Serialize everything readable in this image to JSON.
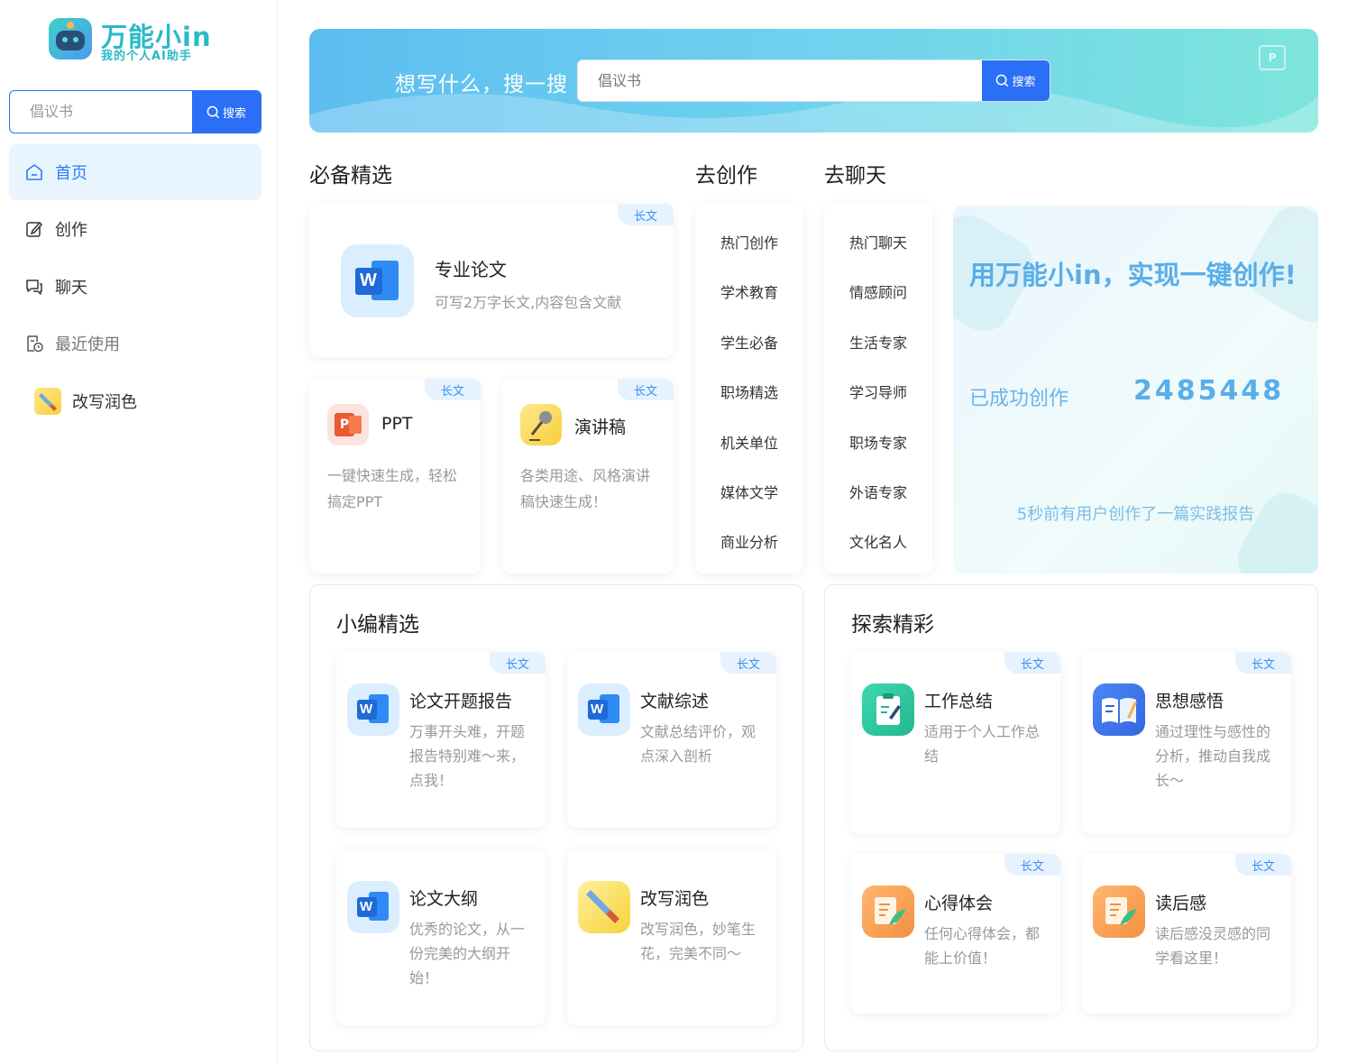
{
  "sidebar": {
    "logo": {
      "title": "万能小in",
      "subtitle": "我的个人AI助手"
    },
    "search": {
      "placeholder": "倡议书",
      "button": "搜索"
    },
    "nav": [
      {
        "label": "首页",
        "icon": "home-icon",
        "active": true
      },
      {
        "label": "创作",
        "icon": "edit-icon"
      },
      {
        "label": "聊天",
        "icon": "chat-icon"
      },
      {
        "label": "最近使用",
        "icon": "recent-icon"
      }
    ],
    "recent": [
      {
        "label": "改写润色",
        "icon": "pen-icon"
      }
    ]
  },
  "banner": {
    "title": "想写什么，搜一搜",
    "search_placeholder": "倡议书",
    "search_button": "搜索",
    "ppt_badge": "P"
  },
  "sections": {
    "featured": "必备精选",
    "create": "去创作",
    "chat": "去聊天",
    "editor_picks": "小编精选",
    "explore": "探索精彩"
  },
  "featured": {
    "main": {
      "title": "专业论文",
      "desc": "可写2万字长文,内容包含文献",
      "tag": "长文"
    },
    "ppt": {
      "title": "PPT",
      "desc": "一键快速生成，轻松搞定PPT",
      "tag": "长文"
    },
    "speech": {
      "title": "演讲稿",
      "desc": "各类用途、风格演讲稿快速生成！",
      "tag": "长文"
    }
  },
  "create_list": [
    "热门创作",
    "学术教育",
    "学生必备",
    "职场精选",
    "机关单位",
    "媒体文学",
    "商业分析"
  ],
  "chat_list": [
    "热门聊天",
    "情感顾问",
    "生活专家",
    "学习导师",
    "职场专家",
    "外语专家",
    "文化名人"
  ],
  "promo": {
    "title": "用万能小in，实现一键创作!",
    "label": "已成功创作",
    "count": "2485448",
    "note": "5秒前有用户创作了一篇实践报告"
  },
  "editor_picks": [
    {
      "title": "论文开题报告",
      "desc": "万事开头难，开题报告特别难～来，点我！",
      "tag": "长文"
    },
    {
      "title": "文献综述",
      "desc": "文献总结评价，观点深入剖析",
      "tag": "长文"
    },
    {
      "title": "论文大纲",
      "desc": "优秀的论文，从一份完美的大纲开始！",
      "tag": ""
    },
    {
      "title": "改写润色",
      "desc": "改写润色，妙笔生花，完美不同～",
      "tag": ""
    }
  ],
  "explore": [
    {
      "title": "工作总结",
      "desc": "适用于个人工作总结",
      "tag": "长文"
    },
    {
      "title": "思想感悟",
      "desc": "通过理性与感性的分析，推动自我成长～",
      "tag": "长文"
    },
    {
      "title": "心得体会",
      "desc": "任何心得体会，都能上价值！",
      "tag": "长文"
    },
    {
      "title": "读后感",
      "desc": "读后感没灵感的同学看这里！",
      "tag": "长文"
    }
  ],
  "colors": {
    "accent": "#2a6ff5",
    "active_bg": "#e8f4fe",
    "tag_bg": "#e6f2fe",
    "tag_text": "#3c8ff0"
  }
}
